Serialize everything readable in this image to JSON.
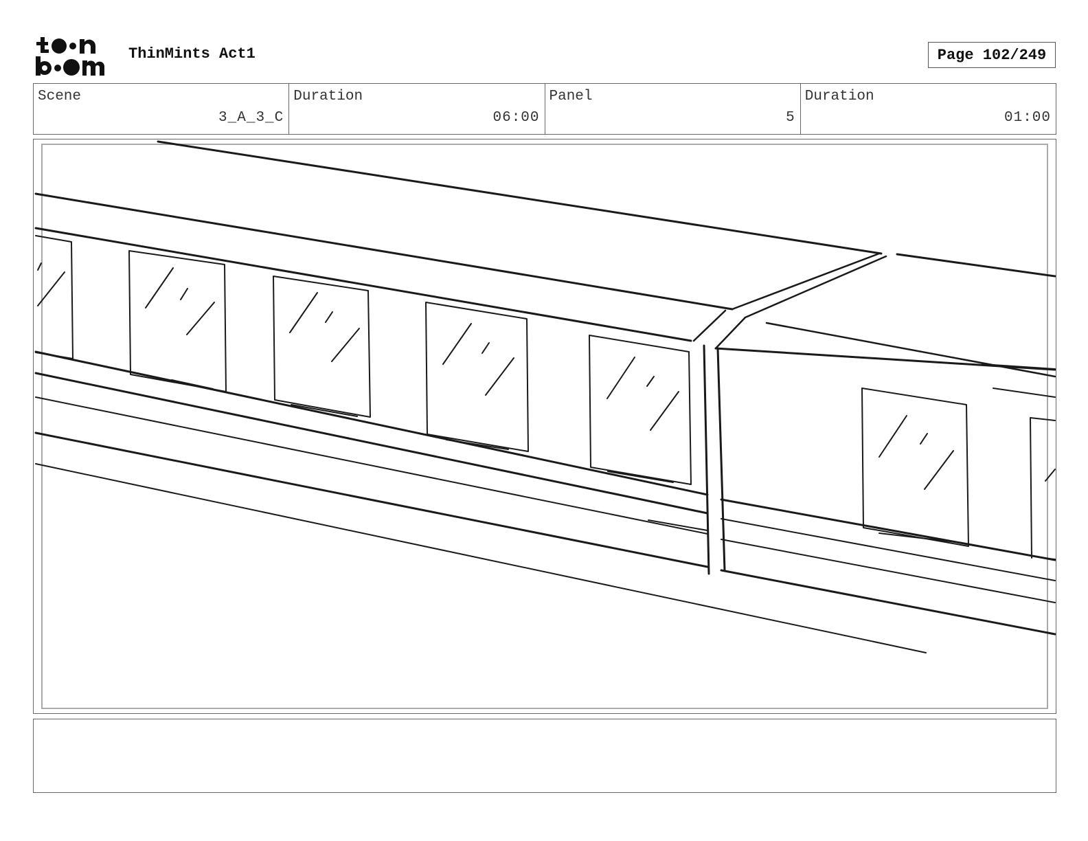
{
  "header": {
    "brand": "toon boom",
    "title": "ThinMints Act1",
    "page_label": "Page 102/249"
  },
  "info": {
    "scene_label": "Scene",
    "scene_value": "3_A_3_C",
    "scene_duration_label": "Duration",
    "scene_duration_value": "06:00",
    "panel_label": "Panel",
    "panel_value": "5",
    "panel_duration_label": "Duration",
    "panel_duration_value": "01:00"
  },
  "panel": {
    "image_subject": "train-sketch"
  },
  "notes": {
    "text": ""
  }
}
